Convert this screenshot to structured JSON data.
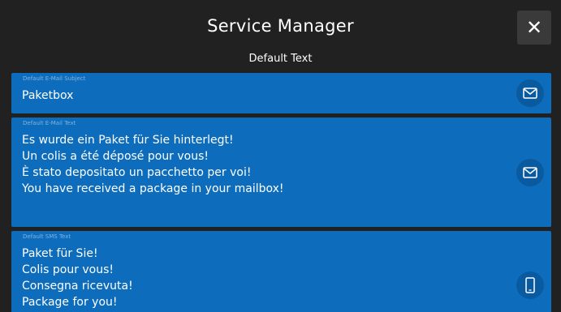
{
  "header": {
    "title": "Service Manager",
    "close_label": "✕"
  },
  "subtitle": "Default Text",
  "cards": [
    {
      "label": "Default E-Mail Subject",
      "text": "Paketbox",
      "icon": "mail-icon"
    },
    {
      "label": "Default E-Mail Text",
      "text": "Es wurde ein Paket für Sie hinterlegt!\nUn colis a été déposé pour vous!\nÈ stato depositato un pacchetto per voi!\nYou have received a package in your mailbox!",
      "icon": "mail-icon"
    },
    {
      "label": "Default SMS Text",
      "text": "Paket für Sie!\nColis pour vous!\nConsegna ricevuta!\nPackage for you!",
      "icon": "phone-icon"
    }
  ],
  "colors": {
    "background": "#212121",
    "card": "#0d6dbc",
    "icon_circle": "#0a5aa0",
    "label": "#7fb4e0",
    "close_button": "#3a3a3a"
  }
}
